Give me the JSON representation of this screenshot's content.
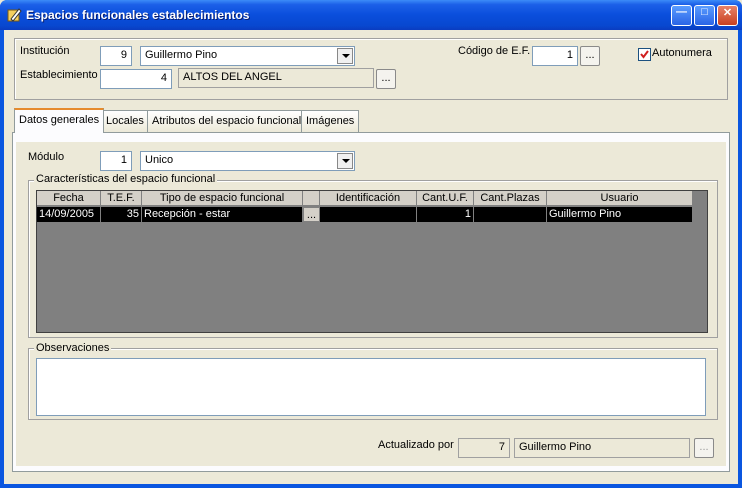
{
  "window": {
    "title": "Espacios funcionales establecimientos"
  },
  "header": {
    "institucion_label": "Institución",
    "institucion_code": "9",
    "institucion_name": "Guillermo Pino",
    "establecimiento_label": "Establecimiento",
    "establecimiento_code": "4",
    "establecimiento_name": "ALTOS DEL ANGEL",
    "codigo_label": "Código de E.F.",
    "codigo_value": "1",
    "autonumera_label": "Autonumera",
    "autonumera_checked": true,
    "dots": "..."
  },
  "tabs": [
    {
      "label": "Datos generales",
      "active": true
    },
    {
      "label": "Locales"
    },
    {
      "label": "Atributos del espacio funcional"
    },
    {
      "label": "Imágenes"
    }
  ],
  "modulo": {
    "label": "Módulo",
    "code": "1",
    "name": "Unico"
  },
  "caracteristicas": {
    "title": "Características del espacio funcional",
    "columns": [
      "Fecha",
      "T.E.F.",
      "Tipo de espacio funcional",
      "",
      "Identificación",
      "Cant.U.F.",
      "Cant.Plazas",
      "Usuario"
    ],
    "rows": [
      [
        "14/09/2005",
        "35",
        "Recepción - estar",
        "...",
        "",
        "1",
        "",
        "Guillermo Pino"
      ]
    ]
  },
  "observaciones": {
    "title": "Observaciones",
    "value": ""
  },
  "footer": {
    "actualizado_label": "Actualizado por",
    "user_code": "7",
    "user_name": "Guillermo Pino"
  },
  "colors": {
    "titlebar": "#0a4edc",
    "selected_row": "#000000",
    "grid_bg": "#808080"
  }
}
